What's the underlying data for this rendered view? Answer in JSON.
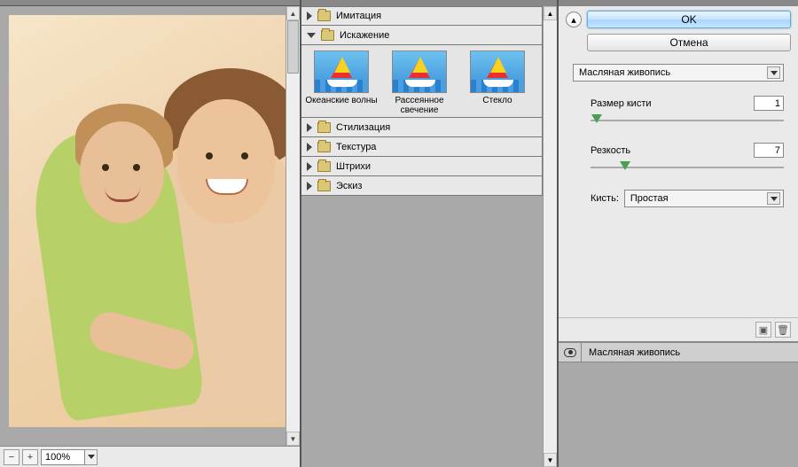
{
  "preview": {
    "zoom": "100%"
  },
  "categories": [
    {
      "label": "Имитация",
      "expanded": false
    },
    {
      "label": "Искажение",
      "expanded": true
    },
    {
      "label": "Стилизация",
      "expanded": false
    },
    {
      "label": "Текстура",
      "expanded": false
    },
    {
      "label": "Штрихи",
      "expanded": false
    },
    {
      "label": "Эскиз",
      "expanded": false
    }
  ],
  "distort_filters": [
    {
      "label": "Океанские волны"
    },
    {
      "label": "Рассеянное свечение"
    },
    {
      "label": "Стекло"
    }
  ],
  "buttons": {
    "ok": "OK",
    "cancel": "Отмена"
  },
  "filter_dropdown": {
    "selected": "Масляная живопись"
  },
  "params": {
    "brush_size": {
      "label": "Размер кисти",
      "value": "1",
      "pos_pct": 3
    },
    "sharpness": {
      "label": "Резкость",
      "value": "7",
      "pos_pct": 18
    }
  },
  "brush": {
    "label": "Кисть:",
    "selected": "Простая"
  },
  "layers": [
    {
      "name": "Масляная живопись",
      "visible": true
    }
  ]
}
